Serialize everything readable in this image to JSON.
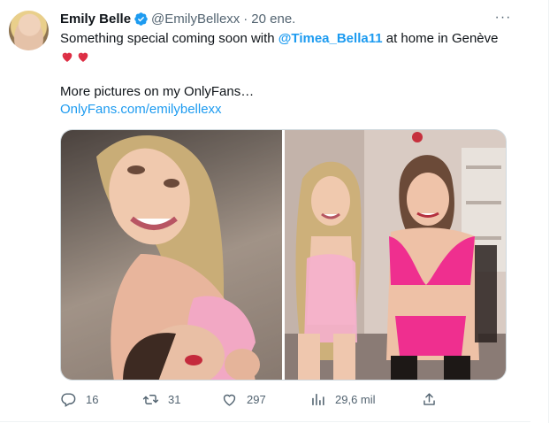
{
  "tweet": {
    "author_name": "Emily Belle",
    "handle": "@EmilyBellexx",
    "separator": "·",
    "date": "20 ene.",
    "text_line1_prefix": "Something special coming soon with ",
    "mention": "@Timea_Bella11",
    "text_line1_suffix": " at home in Genève",
    "text_line3": "More pictures on my OnlyFans…",
    "link": "OnlyFans.com/emilybellexx",
    "more_label": "···"
  },
  "actions": {
    "replies": "16",
    "retweets": "31",
    "likes": "297",
    "views": "29,6 mil"
  },
  "icons": {
    "verified": "verified-badge-icon",
    "heart_emoji": "sparkling-heart-icon",
    "reply": "reply-icon",
    "retweet": "retweet-icon",
    "like": "like-icon",
    "views": "views-icon",
    "share": "share-icon"
  },
  "colors": {
    "accent": "#1d9bf0",
    "secondary_text": "#536471",
    "primary_text": "#0f1419"
  }
}
